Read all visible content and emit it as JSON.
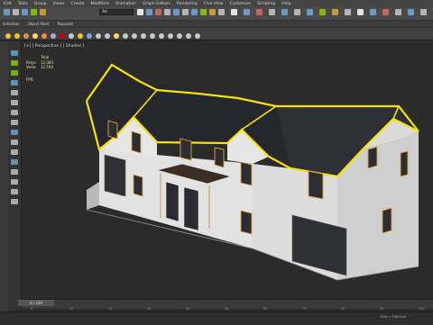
{
  "menubar": {
    "items": [
      "Edit",
      "Tools",
      "Group",
      "Views",
      "Create",
      "Modifiers",
      "Animation",
      "Graph Editors",
      "Rendering",
      "Civil View",
      "Customize",
      "Scripting",
      "Help"
    ]
  },
  "toolbar": {
    "selection_filter": "All",
    "icons": [
      "undo-icon",
      "redo-icon",
      "link-icon",
      "unlink-icon",
      "bind-space-warp-icon",
      "selection-filter-dropdown",
      "select-object-icon",
      "select-by-name-icon",
      "rectangular-selection-icon",
      "window-crossing-icon",
      "select-and-move-icon",
      "select-and-rotate-icon",
      "select-and-scale-icon",
      "reference-coordinate-icon",
      "use-pivot-center-icon",
      "select-and-manipulate-icon",
      "keyboard-shortcut-override-icon",
      "snaps-toggle-icon",
      "angle-snap-icon",
      "percent-snap-icon",
      "spinner-snap-icon",
      "edit-named-selection-icon",
      "mirror-icon",
      "align-icon",
      "toggle-scene-explorer-icon",
      "toggle-layer-explorer-icon",
      "curve-editor-icon",
      "schematic-view-icon",
      "material-editor-icon",
      "render-setup-icon",
      "rendered-frame-window-icon",
      "render-production-icon"
    ]
  },
  "ribbon": {
    "tabs": [
      "Selection",
      "Object Paint",
      "Populate"
    ]
  },
  "viewport": {
    "label": "[+] [ Perspective ] [ Shaded ]",
    "stats": {
      "header": "Total",
      "rows": [
        {
          "key": "Polys:",
          "value": "12,383"
        },
        {
          "key": "Verts:",
          "value": "12,194"
        }
      ],
      "fps": "FPS:"
    }
  },
  "timeline": {
    "frame_counter": "0 / 100",
    "ticks": [
      "0",
      "10",
      "20",
      "30",
      "40",
      "50",
      "60",
      "70",
      "80",
      "90",
      "100"
    ]
  },
  "statusbar": {
    "grid": "Grid = 100,0cm"
  },
  "colors": {
    "selection_outline": "#f5e400",
    "roof": "#26272e",
    "wall": "#e6e6e6",
    "window_frame": "#e0a43a",
    "viewport_bg": "#2b2b2b"
  }
}
